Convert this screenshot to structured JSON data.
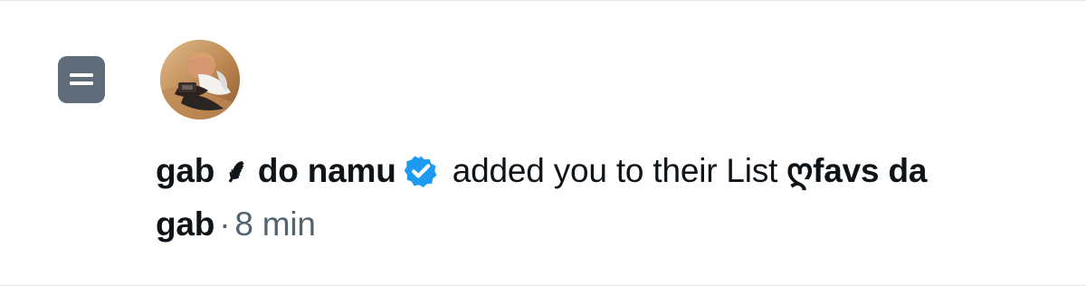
{
  "notification": {
    "type_icon": "list-icon",
    "avatar_icon": "user-avatar",
    "actor_name": "gab ⸙ do namu",
    "verified_icon": "verified-badge-icon",
    "action_text": " added you to their List ",
    "list_name": "ღfavs da gab",
    "separator": "·",
    "time": "8 min",
    "accent_color": "#1d9bf0",
    "muted_color": "#536471"
  }
}
